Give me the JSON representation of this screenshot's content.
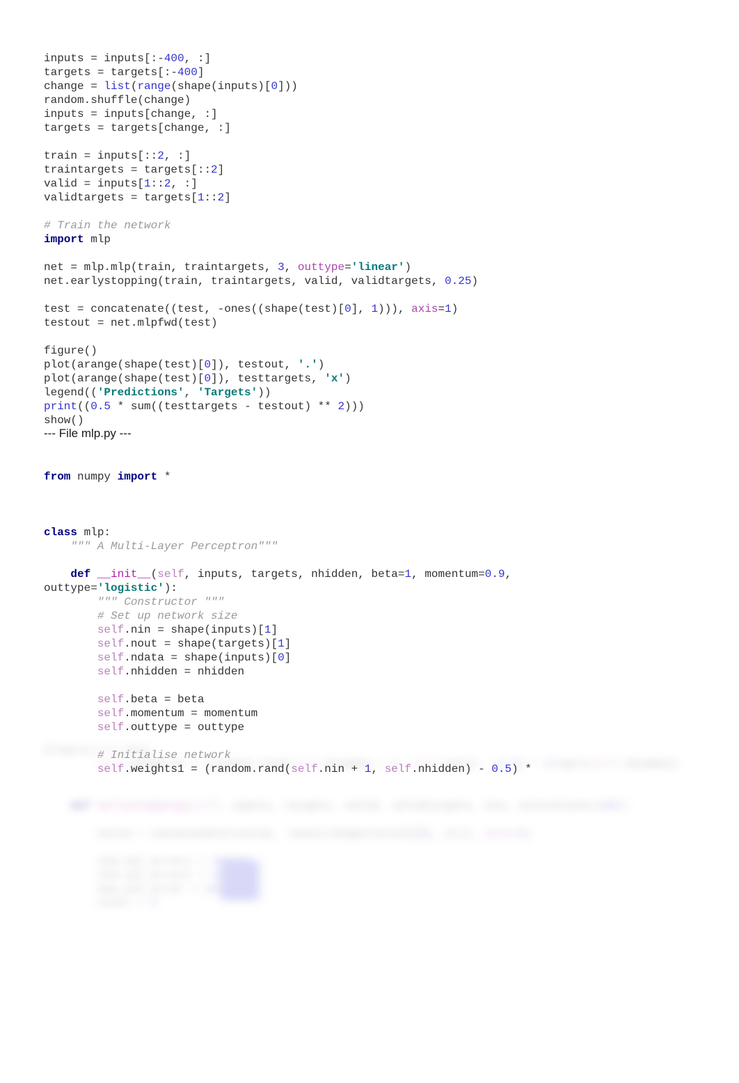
{
  "document": {
    "background": "#ffffff",
    "title_text": "--- File mlp.py ---"
  },
  "colors": {
    "keyword": "#000080",
    "number": "#3333cc",
    "string": "#0b7a7a",
    "comment": "#9a9a9a",
    "self": "#bb7fbb",
    "magic_method": "#aa22aa",
    "parameter": "#aa44aa",
    "builtin": "#3333cc",
    "plain_text": "#333333"
  },
  "code_top": {
    "lines": [
      "inputs = inputs[:-400, :]",
      "targets = targets[:-400]",
      "change = list(range(shape(inputs)[0]))",
      "random.shuffle(change)",
      "inputs = inputs[change, :]",
      "targets = targets[change, :]",
      "",
      "train = inputs[::2, :]",
      "traintargets = targets[::2]",
      "valid = inputs[1::2, :]",
      "validtargets = targets[1::2]",
      "",
      "# Train the network",
      "import mlp",
      "",
      "net = mlp.mlp(train, traintargets, 3, outtype='linear')",
      "net.earlystopping(train, traintargets, valid, validtargets, 0.25)",
      "",
      "test = concatenate((test, -ones((shape(test)[0], 1))), axis=1)",
      "testout = net.mlpfwd(test)",
      "",
      "figure()",
      "plot(arange(shape(test)[0]), testout, '.')",
      "plot(arange(shape(test)[0]), testtargets, 'x')",
      "legend(('Predictions', 'Targets'))",
      "print((0.5 * sum((testtargets - testout) ** 2)))",
      "show()"
    ]
  },
  "file_header": {
    "label": "--- File mlp.py ---"
  },
  "code_bottom": {
    "lines": [
      "from numpy import *",
      "",
      "",
      "class mlp:",
      "    \"\"\" A Multi-Layer Perceptron\"\"\"",
      "",
      "    def __init__(self, inputs, targets, nhidden, beta=1, momentum=0.9,",
      "outtype='logistic'):",
      "        \"\"\" Constructor \"\"\"",
      "        # Set up network size",
      "        self.nin = shape(inputs)[1]",
      "        self.nout = shape(targets)[1]",
      "        self.ndata = shape(inputs)[0]",
      "        self.nhidden = nhidden",
      "",
      "        self.beta = beta",
      "        self.momentum = momentum",
      "        self.outtype = outtype",
      "",
      "        # Initialise network",
      "        self.weights1 = (random.rand(self.nin + 1, self.nhidden) - 0.5) *"
    ]
  },
  "blurred_tail": {
    "note": "faded/blurred continuation of the source listing",
    "lines": [
      "2/sqrt(self.nin)",
      "        self.weights2 = (random.rand(self.nhidden + 1, self.nout) - 0.5) * 2/sqrt(self.nhidden)",
      "",
      "    def earlystopping(self, inputs, targets, valid, validtargets, eta, niterations=100):",
      "        valid = concatenate((valid, -ones((shape(valid)[0], 1))), axis=1)",
      "",
      "        old_val_error1 = 100002",
      "        old_val_error2 = 100001",
      "        new_val_error = 100000",
      "        count = 0"
    ]
  }
}
